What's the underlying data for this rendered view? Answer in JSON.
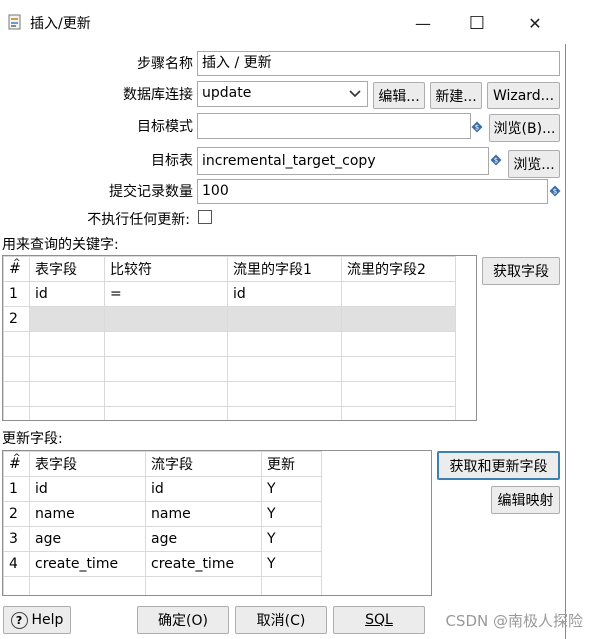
{
  "window": {
    "title": "插入/更新",
    "minimize_glyph": "—",
    "maximize_glyph": "☐",
    "close_glyph": "✕"
  },
  "form": {
    "step_name_label": "步骤名称",
    "step_name_value": "插入 / 更新",
    "connection_label": "数据库连接",
    "connection_value": "update",
    "edit_button": "编辑...",
    "new_button": "新建...",
    "wizard_button": "Wizard...",
    "target_schema_label": "目标模式",
    "target_schema_value": "",
    "browse_schema_button": "浏览(B)...",
    "target_table_label": "目标表",
    "target_table_value": "incremental_target_copy",
    "browse_table_button": "浏览...",
    "commit_size_label": "提交记录数量",
    "commit_size_value": "100",
    "no_update_label": "不执行任何更新:",
    "no_update_checked": false
  },
  "keys_section": {
    "label": "用来查询的关键字:",
    "get_fields_button": "获取字段",
    "columns": [
      "#",
      "表字段",
      "比较符",
      "流里的字段1",
      "流里的字段2"
    ],
    "rows": [
      [
        "1",
        "id",
        "=",
        "id",
        ""
      ],
      [
        "2",
        "",
        "",
        "",
        ""
      ]
    ]
  },
  "update_section": {
    "label": "更新字段:",
    "get_update_fields_button": "获取和更新字段",
    "edit_mapping_button": "编辑映射",
    "columns": [
      "#",
      "表字段",
      "流字段",
      "更新"
    ],
    "rows": [
      [
        "1",
        "id",
        "id",
        "Y"
      ],
      [
        "2",
        "name",
        "name",
        "Y"
      ],
      [
        "3",
        "age",
        "age",
        "Y"
      ],
      [
        "4",
        "create_time",
        "create_time",
        "Y"
      ]
    ]
  },
  "footer": {
    "help_button": "Help",
    "ok_button": "确定(O)",
    "cancel_button": "取消(C)",
    "sql_button": "SQL"
  },
  "watermark": "CSDN @南极人探险",
  "colors": {
    "accent": "#3c7fb1",
    "selected_row": "#e0e0e0",
    "variable_icon": "#3a6ea5"
  },
  "icons": {
    "app": "transform-step-icon",
    "variable": "variable-diamond-icon",
    "dropdown": "chevron-down-icon",
    "help": "question-circle-icon"
  }
}
